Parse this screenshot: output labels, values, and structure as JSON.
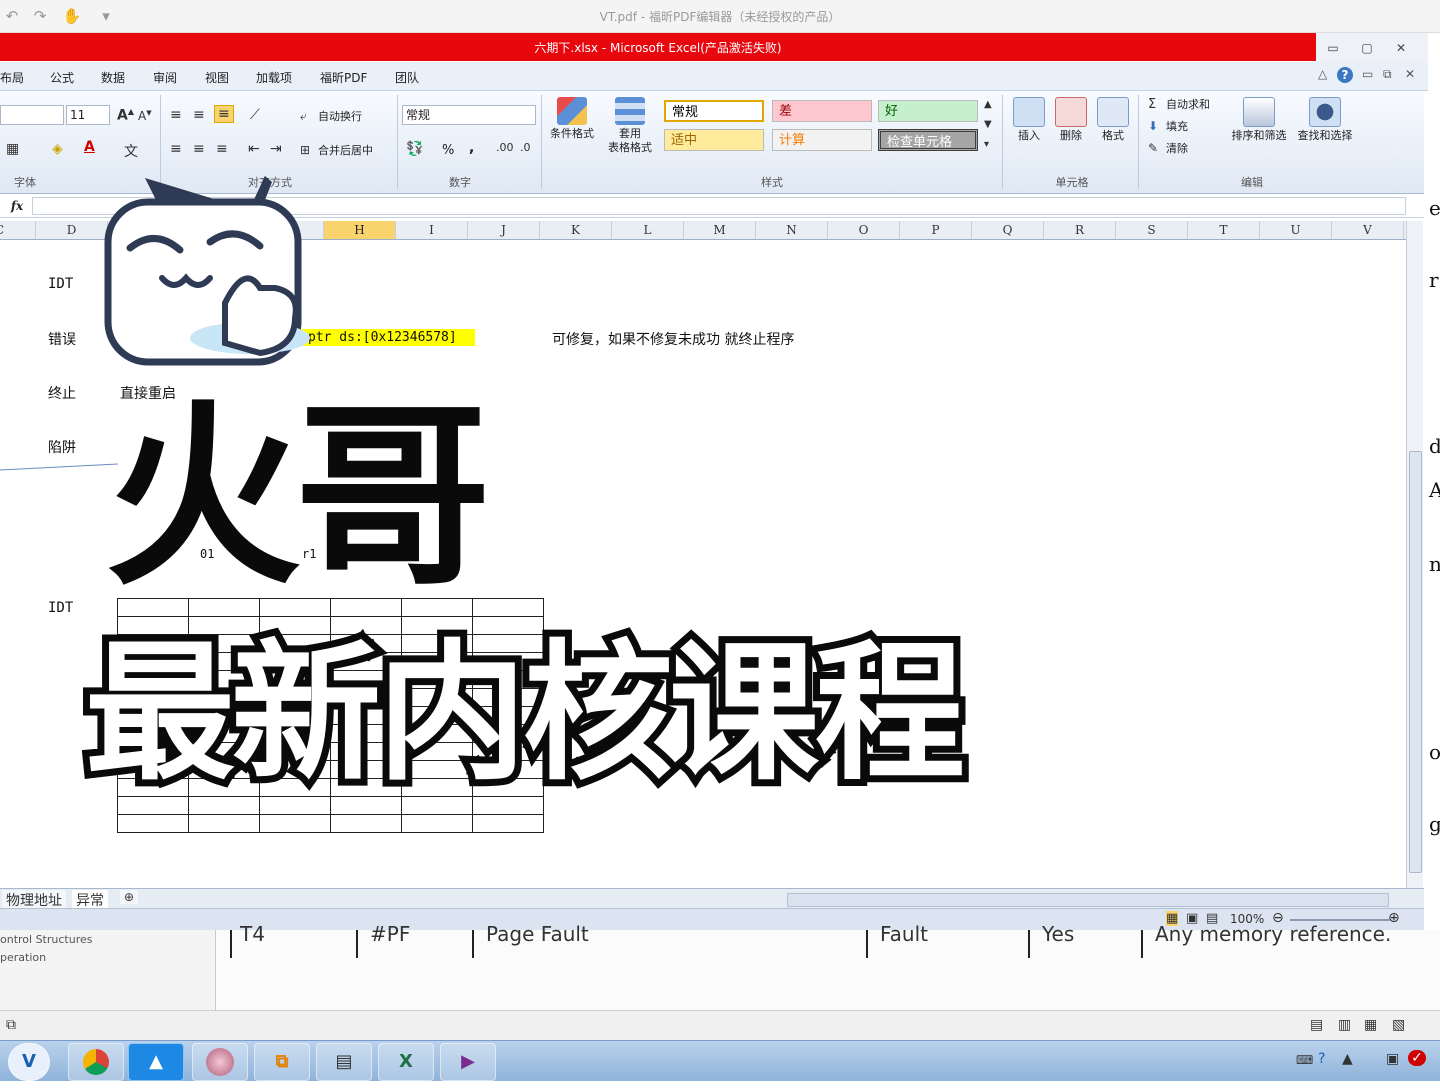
{
  "pdf_window": {
    "title": "VT.pdf - 福昕PDF编辑器（未经授权的产品）"
  },
  "excel": {
    "title": "六期下.xlsx - Microsoft Excel(产品激活失败)",
    "tabs": [
      "布局",
      "公式",
      "数据",
      "审阅",
      "视图",
      "加载项",
      "福昕PDF",
      "团队"
    ],
    "ribbon": {
      "font_size": "11",
      "number_format": "常规",
      "wrap_text": "自动换行",
      "merge_center": "合并后居中",
      "percent": "%",
      "comma": ",",
      "conditional_format": "条件格式",
      "table_format_1": "套用",
      "table_format_2": "表格格式",
      "styles": [
        {
          "label": "常规",
          "bg": "#ffffff",
          "color": "#000000"
        },
        {
          "label": "差",
          "bg": "#ffc7ce",
          "color": "#9c0006"
        },
        {
          "label": "好",
          "bg": "#c6efce",
          "color": "#006100"
        },
        {
          "label": "适中",
          "bg": "#ffeb9c",
          "color": "#9c6500"
        },
        {
          "label": "计算",
          "bg": "#f2f2f2",
          "color": "#fa7d00"
        },
        {
          "label": "检查单元格",
          "bg": "#a5a5a5",
          "color": "#ffffff"
        }
      ],
      "insert": "插入",
      "delete": "删除",
      "format": "格式",
      "autosum": "自动求和",
      "fill": "填充",
      "clear": "清除",
      "sort_filter": "排序和筛选",
      "find_select": "查找和选择",
      "groups": {
        "font": "字体",
        "alignment": "对齐方式",
        "number": "数字",
        "styles": "样式",
        "cells": "单元格",
        "editing": "编辑"
      }
    },
    "columns": [
      "C",
      "D",
      "E",
      "F",
      "G",
      "H",
      "I",
      "J",
      "K",
      "L",
      "M",
      "N",
      "O",
      "P",
      "Q",
      "R",
      "S",
      "T",
      "U",
      "V"
    ],
    "selected_column": "H",
    "cells": {
      "idt1": "IDT",
      "error": "错误",
      "error_code": "ptr ds:[0x12346578]",
      "error_note": "可修复，如果不修复未成功 就终止程序",
      "abort": "终止",
      "abort_note": "直接重启",
      "trap": "陷阱",
      "frag1": "01",
      "frag2": "r1",
      "idt2": "IDT"
    },
    "sheet_tabs": [
      "物理地址",
      "异常"
    ],
    "zoom": "100%"
  },
  "pdf_background": {
    "outline": [
      "ontrol Structures",
      "peration"
    ],
    "table_row": [
      "T4",
      "#PF",
      "Page Fault",
      "Fault",
      "Yes",
      "Any memory reference."
    ]
  },
  "overlay": {
    "line1": "火哥",
    "line2": "最新内核课程"
  },
  "taskbar": {
    "apps": [
      "vpn-app",
      "chrome",
      "cloud-app",
      "anime-avatar",
      "remote-app",
      "terminal",
      "excel",
      "foxit-pdf"
    ]
  }
}
